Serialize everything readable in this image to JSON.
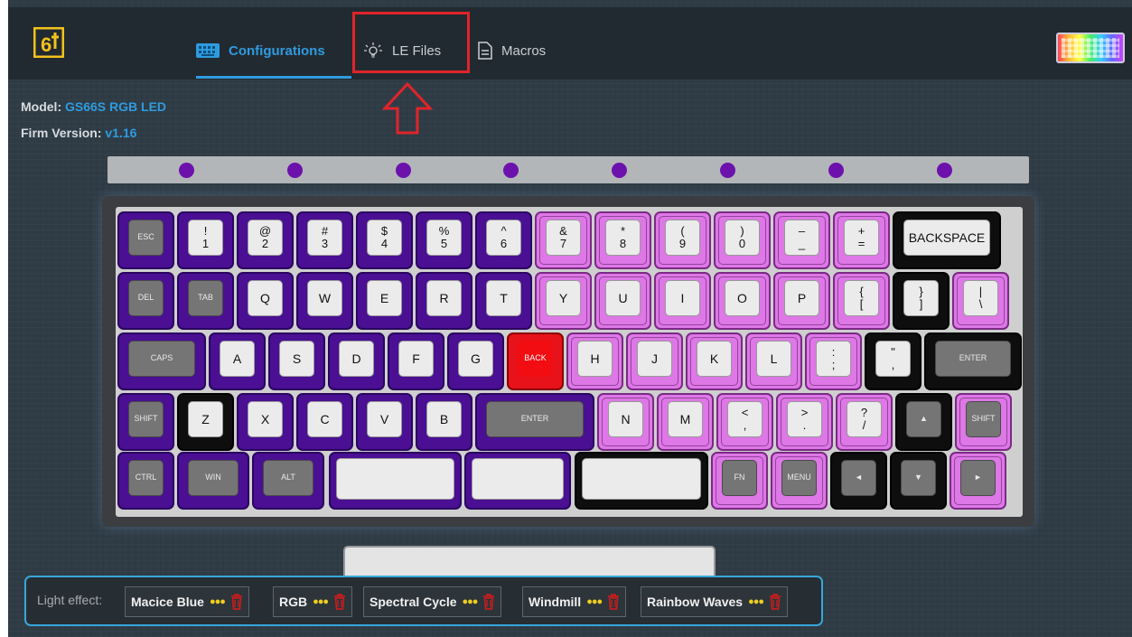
{
  "nav": {
    "tabs": [
      {
        "label": "Configurations",
        "icon": "keyboard-icon"
      },
      {
        "label": "LE Files",
        "icon": "light-bulb-icon"
      },
      {
        "label": "Macros",
        "icon": "document-icon"
      }
    ],
    "active_tab": "Configurations",
    "logo": "6t-logo",
    "keyboard_thumbnail": "rgb-keyboard-image"
  },
  "device": {
    "model_label": "Model:",
    "model_value": "GS66S RGB LED",
    "firm_label": "Firm Version:",
    "firm_value": "v1.16"
  },
  "led_bar": {
    "count": 8,
    "color": "#6d11ad"
  },
  "keyboard": {
    "row1": [
      {
        "t": "ESC"
      },
      {
        "t": "!",
        "b": "1"
      },
      {
        "t": "@",
        "b": "2"
      },
      {
        "t": "#",
        "b": "3"
      },
      {
        "t": "$",
        "b": "4"
      },
      {
        "t": "%",
        "b": "5"
      },
      {
        "t": "^",
        "b": "6"
      },
      {
        "t": "&",
        "b": "7"
      },
      {
        "t": "*",
        "b": "8"
      },
      {
        "t": "(",
        "b": "9"
      },
      {
        "t": ")",
        "b": "0"
      },
      {
        "t": "–",
        "b": "_"
      },
      {
        "t": "+",
        "b": "="
      },
      {
        "t": "BACKSPACE"
      }
    ],
    "row2": [
      {
        "t": "DEL"
      },
      {
        "t": "TAB"
      },
      {
        "t": "Q"
      },
      {
        "t": "W"
      },
      {
        "t": "E"
      },
      {
        "t": "R"
      },
      {
        "t": "T"
      },
      {
        "t": "Y"
      },
      {
        "t": "U"
      },
      {
        "t": "I"
      },
      {
        "t": "O"
      },
      {
        "t": "P"
      },
      {
        "t": "{",
        "b": "["
      },
      {
        "t": "}",
        "b": "]"
      },
      {
        "t": "|",
        "b": "\\"
      }
    ],
    "row3": [
      {
        "t": "CAPS"
      },
      {
        "t": "A"
      },
      {
        "t": "S"
      },
      {
        "t": "D"
      },
      {
        "t": "F"
      },
      {
        "t": "G"
      },
      {
        "t": "BACK"
      },
      {
        "t": "H"
      },
      {
        "t": "J"
      },
      {
        "t": "K"
      },
      {
        "t": "L"
      },
      {
        "t": ":",
        "b": ";"
      },
      {
        "t": "\"",
        "b": ","
      },
      {
        "t": "ENTER"
      }
    ],
    "row4": [
      {
        "t": "SHIFT"
      },
      {
        "t": "Z"
      },
      {
        "t": "X"
      },
      {
        "t": "C"
      },
      {
        "t": "V"
      },
      {
        "t": "B"
      },
      {
        "t": "ENTER"
      },
      {
        "t": "N"
      },
      {
        "t": "M"
      },
      {
        "t": "<",
        "b": ","
      },
      {
        "t": ">",
        "b": "."
      },
      {
        "t": "?",
        "b": "/"
      },
      {
        "t": "▲"
      },
      {
        "t": "SHIFT"
      }
    ],
    "row5": [
      {
        "t": "CTRL"
      },
      {
        "t": "WIN"
      },
      {
        "t": "ALT"
      },
      {
        "t": ""
      },
      {
        "t": ""
      },
      {
        "t": ""
      },
      {
        "t": "FN"
      },
      {
        "t": "MENU"
      },
      {
        "t": "◄"
      },
      {
        "t": "▼"
      },
      {
        "t": "►"
      }
    ],
    "colors": {
      "purple": "#4a0f93",
      "pink": "#dd78e6",
      "black": "#0e0e0e",
      "red": "#e8121a"
    }
  },
  "light_effect": {
    "label": "Light effect:",
    "items": [
      {
        "name": "Macice Blue"
      },
      {
        "name": "RGB"
      },
      {
        "name": "Spectral Cycle"
      },
      {
        "name": "Windmill"
      },
      {
        "name": "Rainbow Waves"
      }
    ]
  },
  "annotation": {
    "highlight_color": "#e0242a"
  }
}
